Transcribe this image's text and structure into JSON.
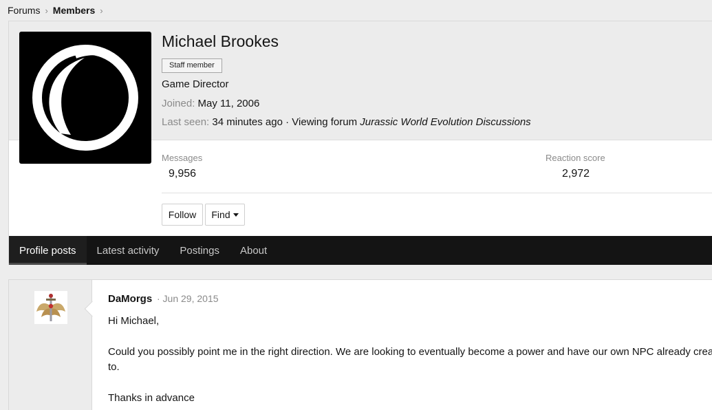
{
  "breadcrumb": [
    {
      "label": "Forums"
    },
    {
      "label": "Members"
    }
  ],
  "profile": {
    "name": "Michael Brookes",
    "badge": "Staff member",
    "role": "Game Director",
    "joined_label": "Joined:",
    "joined_value": "May 11, 2006",
    "lastseen_label": "Last seen:",
    "lastseen_value": "34 minutes ago",
    "activity_prefix": "· Viewing forum",
    "activity_forum": "Jurassic World Evolution Discussions"
  },
  "stats": {
    "messages_label": "Messages",
    "messages_value": "9,956",
    "reaction_label": "Reaction score",
    "reaction_value": "2,972"
  },
  "actions": {
    "follow": "Follow",
    "find": "Find"
  },
  "tabs": [
    {
      "label": "Profile posts",
      "active": true
    },
    {
      "label": "Latest activity"
    },
    {
      "label": "Postings"
    },
    {
      "label": "About"
    }
  ],
  "post": {
    "author": "DaMorgs",
    "date": "· Jun 29, 2015",
    "lines": [
      "Hi Michael,",
      "Could you possibly point me in the right direction. We are looking to eventually become a power and have our own NPC already crea",
      "to.",
      "Thanks in advance"
    ]
  },
  "icons": {
    "avatar_logo": "ring-logo-icon",
    "post_avatar": "sword-wings-emblem-icon"
  }
}
